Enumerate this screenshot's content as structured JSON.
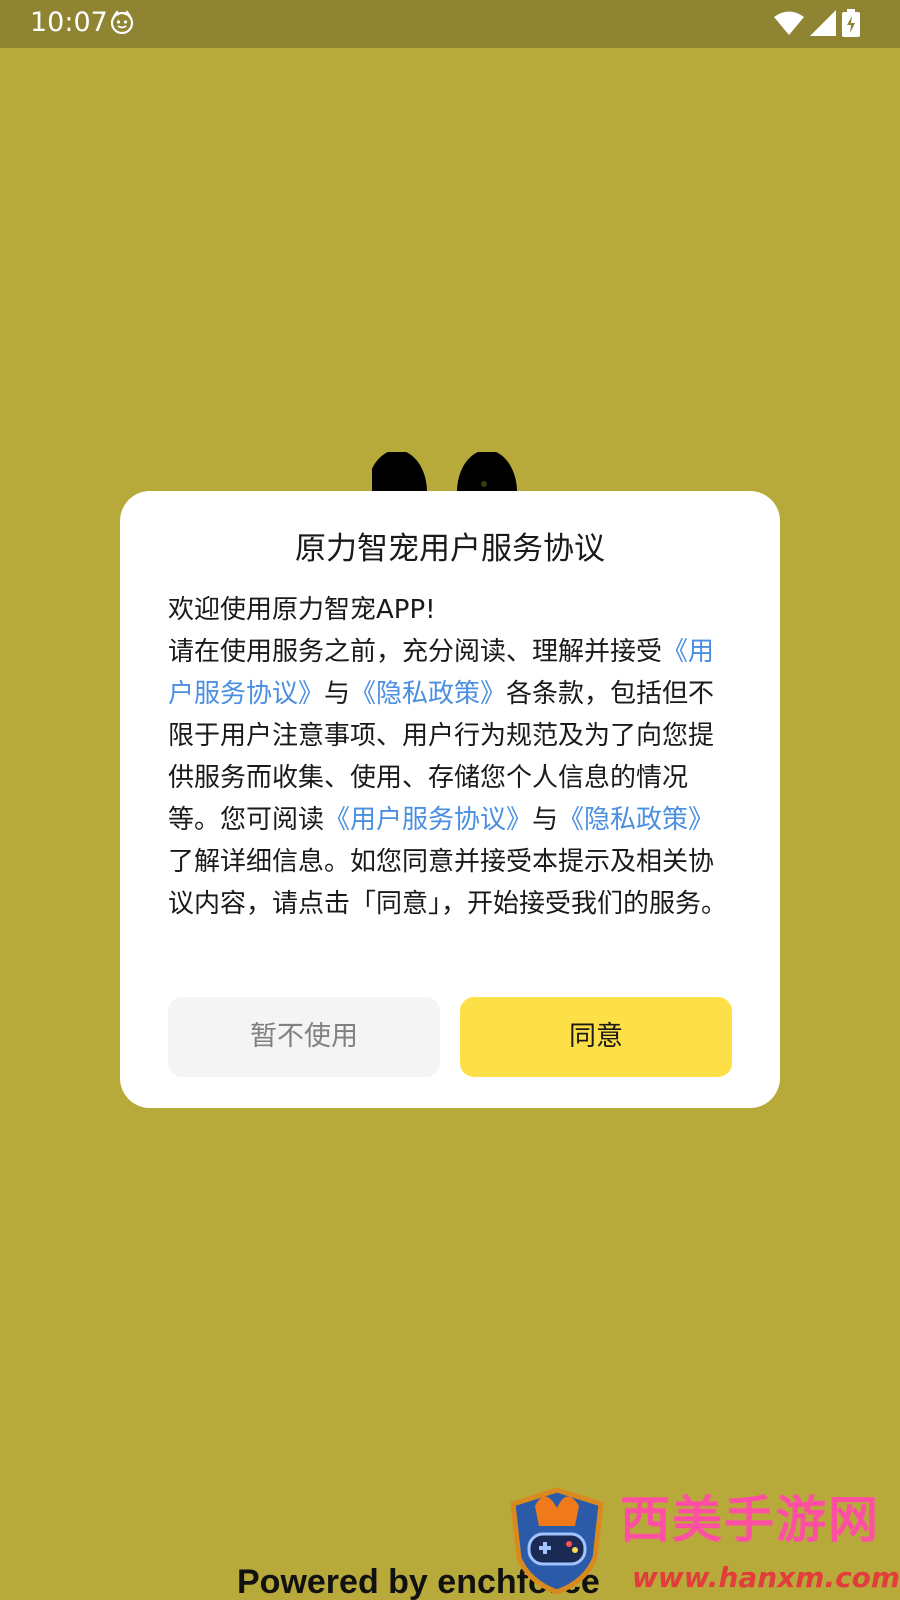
{
  "status_bar": {
    "time": "10:07",
    "notification_icon": "face-icon",
    "wifi_icon": "wifi-icon",
    "signal_icon": "signal-icon",
    "battery_icon": "battery-charging-icon"
  },
  "dialog": {
    "title": "原力智宠用户服务协议",
    "welcome": "欢迎使用原力智宠APP!",
    "text_1": "请在使用服务之前，充分阅读、理解并接受",
    "link_user_agreement_1": "《用户服务协议》",
    "text_and_1": "与",
    "link_privacy_1": "《隐私政策》",
    "text_2": "各条款，包括但不限于用户注意事项、用户行为规范及为了向您提供服务而收集、使用、存储您个人信息的情况等。您可阅读",
    "link_user_agreement_2": "《用户服务协议》",
    "text_and_2": "与",
    "link_privacy_2": "《隐私政策》",
    "text_3": "了解详细信息。如您同意并接受本提示及相关协议内容，请点击「同意」，开始接受我们的服务。",
    "decline_label": "暂不使用",
    "agree_label": "同意"
  },
  "footer": {
    "powered_by": "Powered by  enchforce"
  },
  "watermark": {
    "title": "西美手游网",
    "url": "www.hanxm.com"
  },
  "colors": {
    "background": "#b7aa3b",
    "status_bar": "#8e8432",
    "link": "#4a8fe0",
    "agree_button": "#fde047",
    "decline_button": "#f4f4f4"
  }
}
